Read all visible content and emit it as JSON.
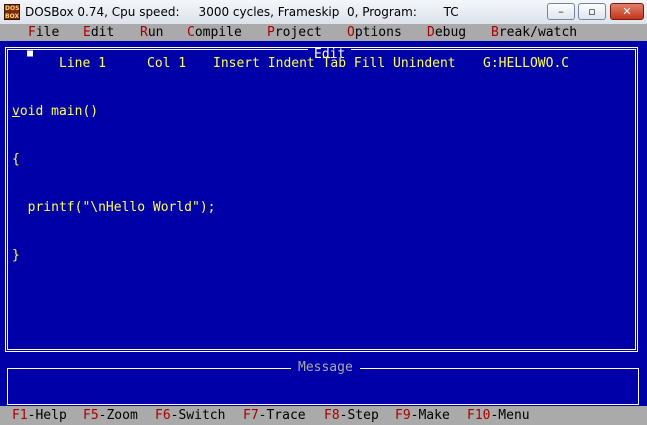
{
  "window": {
    "app_icon_text": "DOS BOX",
    "title": "DOSBox 0.74, Cpu speed:     3000 cycles, Frameskip  0, Program:       TC",
    "min_glyph": "–",
    "max_glyph": "▫",
    "close_glyph": "✕"
  },
  "menu": {
    "items": [
      {
        "hot": "F",
        "rest": "ile"
      },
      {
        "hot": "E",
        "rest": "dit"
      },
      {
        "hot": "R",
        "rest": "un"
      },
      {
        "hot": "C",
        "rest": "ompile"
      },
      {
        "hot": "P",
        "rest": "roject"
      },
      {
        "hot": "O",
        "rest": "ptions"
      },
      {
        "hot": "D",
        "rest": "ebug"
      },
      {
        "hot": "B",
        "rest": "reak/watch"
      }
    ]
  },
  "editor": {
    "title": "Edit",
    "close_glyph": "■",
    "status": {
      "line": "Line 1",
      "col": "Col 1",
      "modes": "Insert Indent Tab Fill Unindent",
      "file": "G:HELLOWO.C"
    },
    "code": {
      "line1_first": "v",
      "line1_rest": "oid main()",
      "line2": "{",
      "line3": "  printf(\"\\nHello World\");",
      "line4": "}"
    }
  },
  "message": {
    "title": "Message"
  },
  "fkeys": {
    "items": [
      {
        "key": "F1",
        "label": "-Help"
      },
      {
        "key": "F5",
        "label": "-Zoom"
      },
      {
        "key": "F6",
        "label": "-Switch"
      },
      {
        "key": "F7",
        "label": "-Trace"
      },
      {
        "key": "F8",
        "label": "-Step"
      },
      {
        "key": "F9",
        "label": "-Make"
      },
      {
        "key": "F10",
        "label": "-Menu"
      }
    ]
  }
}
